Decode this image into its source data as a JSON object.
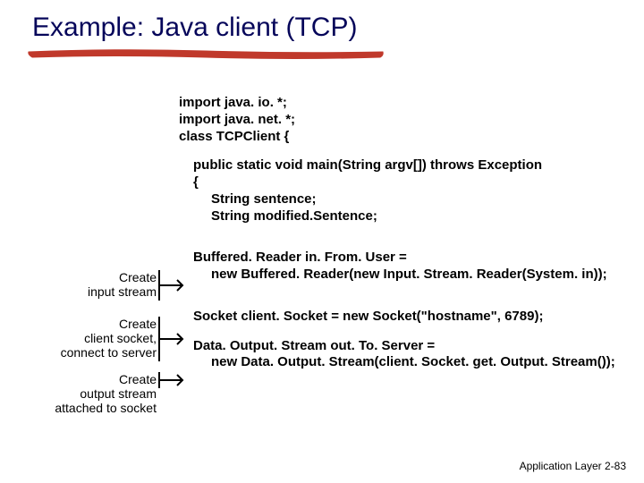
{
  "title": "Example: Java client (TCP)",
  "code": {
    "import1": "import java. io. *;",
    "import2": "import java. net. *;",
    "classdecl": "class TCPClient {",
    "main1": "public static void main(String argv[]) throws Exception",
    "main2": "{",
    "var1": "String sentence;",
    "var2": "String modified.Sentence;",
    "buf1": "Buffered. Reader in. From. User =",
    "buf2": "new Buffered. Reader(new Input. Stream. Reader(System. in));",
    "sock": "Socket client. Socket = new Socket(\"hostname\", 6789);",
    "out1": "Data. Output. Stream out. To. Server =",
    "out2": "new Data. Output. Stream(client. Socket. get. Output. Stream());"
  },
  "annotations": {
    "a1_l1": "Create",
    "a1_l2": "input stream",
    "a2_l1": "Create",
    "a2_l2": "client socket,",
    "a2_l3": "connect to server",
    "a3_l1": "Create",
    "a3_l2": "output stream",
    "a3_l3": "attached to socket"
  },
  "footer": {
    "label": "Application Layer",
    "page": "2-83"
  }
}
